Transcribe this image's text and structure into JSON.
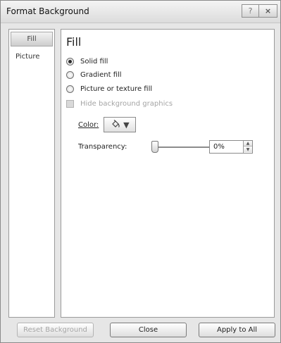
{
  "window": {
    "title": "Format Background",
    "help_button": "?",
    "close_button": "×"
  },
  "sidebar": {
    "items": [
      {
        "label": "Fill",
        "selected": true
      },
      {
        "label": "Picture",
        "selected": false
      }
    ]
  },
  "fill": {
    "heading": "Fill",
    "options": [
      {
        "label": "Solid fill",
        "selected": true
      },
      {
        "label": "Gradient fill",
        "selected": false
      },
      {
        "label": "Picture or texture fill",
        "selected": false
      }
    ],
    "hide_graphics": {
      "label": "Hide background graphics",
      "checked": false,
      "enabled": false
    },
    "color": {
      "label": "Color:",
      "dropdown_arrow": "▼",
      "icon": "paint-bucket-icon"
    },
    "transparency": {
      "label": "Transparency:",
      "value": "0%",
      "level": 0
    }
  },
  "footer": {
    "reset_label": "Reset Background",
    "close_label": "Close",
    "apply_label": "Apply to All"
  },
  "colors": {
    "titlebar": "#dcdcdc",
    "dialog_bg": "#e6e6e6",
    "panel_bg": "#ffffff",
    "disabled_text": "#a4a4a4"
  }
}
